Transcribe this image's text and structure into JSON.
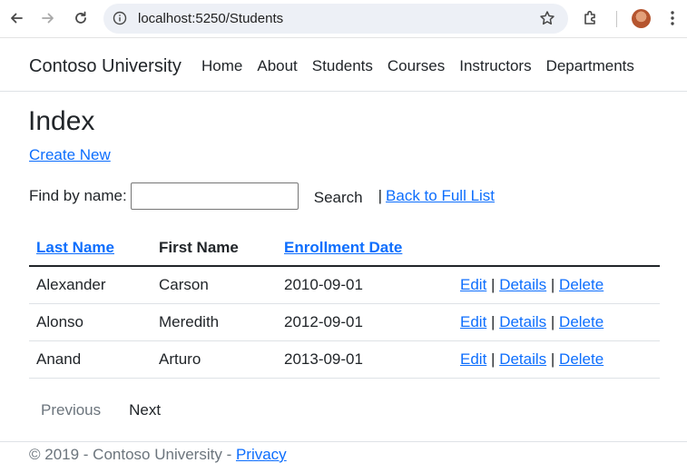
{
  "browser": {
    "url": "localhost:5250/Students"
  },
  "navbar": {
    "brand": "Contoso University",
    "links": [
      "Home",
      "About",
      "Students",
      "Courses",
      "Instructors",
      "Departments"
    ]
  },
  "page": {
    "title": "Index",
    "create_new": "Create New",
    "find_label": "Find by name:",
    "search_value": "",
    "search_button": "Search",
    "separator": "|",
    "back_link": "Back to Full List"
  },
  "table": {
    "headers": {
      "last_name": "Last Name",
      "first_name": "First Name",
      "enrollment_date": "Enrollment Date"
    },
    "rows": [
      {
        "last": "Alexander",
        "first": "Carson",
        "date": "2010-09-01"
      },
      {
        "last": "Alonso",
        "first": "Meredith",
        "date": "2012-09-01"
      },
      {
        "last": "Anand",
        "first": "Arturo",
        "date": "2013-09-01"
      }
    ],
    "actions": {
      "edit": "Edit",
      "details": "Details",
      "delete": "Delete",
      "sep": "|"
    }
  },
  "pager": {
    "previous": "Previous",
    "next": "Next"
  },
  "footer": {
    "text": "© 2019 - Contoso University - ",
    "privacy": "Privacy"
  },
  "colors": {
    "link": "#0d6efd",
    "text": "#212529",
    "muted": "#6c757d"
  }
}
